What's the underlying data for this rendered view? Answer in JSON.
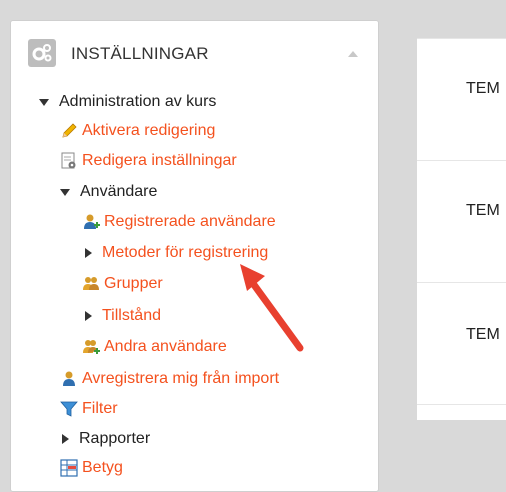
{
  "block": {
    "title": "INSTÄLLNINGAR",
    "icon": "gear-icon"
  },
  "tree": {
    "course_admin": "Administration av kurs",
    "turn_editing_on": "Aktivera redigering",
    "edit_settings": "Redigera inställningar",
    "users": "Användare",
    "enrolled_users": "Registrerade användare",
    "enrolment_methods": "Metoder för registrering",
    "groups": "Grupper",
    "permissions": "Tillstånd",
    "other_users": "Andra användare",
    "unenrol": "Avregistrera mig från import",
    "filters": "Filter",
    "reports": "Rapporter",
    "grades": "Betyg"
  },
  "right_panel": {
    "rows": [
      "TEM",
      "TEM",
      "TEM"
    ]
  },
  "colors": {
    "link": "#f4511e",
    "arrow": "#e8402f"
  }
}
